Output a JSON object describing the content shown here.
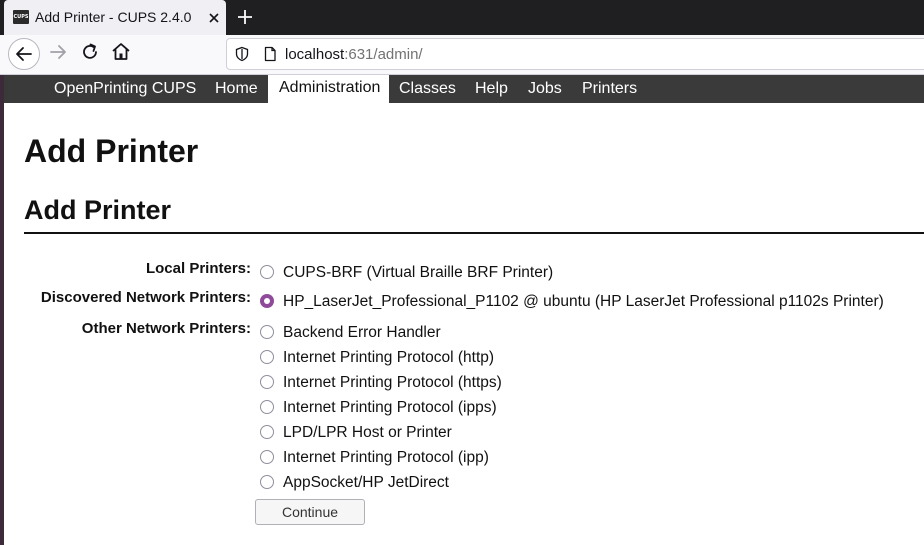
{
  "browser": {
    "tab": {
      "favicon_text": "CUPS",
      "title": "Add Printer - CUPS 2.4.0"
    },
    "url": {
      "host": "localhost",
      "rest": ":631/admin/"
    }
  },
  "cups_menu": {
    "items": [
      "OpenPrinting CUPS",
      "Home",
      "Administration",
      "Classes",
      "Help",
      "Jobs",
      "Printers"
    ],
    "active": "Administration"
  },
  "page": {
    "title": "Add Printer",
    "section_title": "Add Printer",
    "groups": [
      {
        "label": "Local Printers:",
        "options": [
          {
            "label": "CUPS-BRF (Virtual Braille BRF Printer)",
            "checked": false
          }
        ]
      },
      {
        "label": "Discovered Network Printers:",
        "options": [
          {
            "label": "HP_LaserJet_Professional_P1102 @ ubuntu (HP LaserJet Professional p1102s Printer)",
            "checked": true
          }
        ]
      },
      {
        "label": "Other Network Printers:",
        "options": [
          {
            "label": "Backend Error Handler",
            "checked": false
          },
          {
            "label": "Internet Printing Protocol (http)",
            "checked": false
          },
          {
            "label": "Internet Printing Protocol (https)",
            "checked": false
          },
          {
            "label": "Internet Printing Protocol (ipps)",
            "checked": false
          },
          {
            "label": "LPD/LPR Host or Printer",
            "checked": false
          },
          {
            "label": "Internet Printing Protocol (ipp)",
            "checked": false
          },
          {
            "label": "AppSocket/HP JetDirect",
            "checked": false
          }
        ]
      }
    ],
    "continue_label": "Continue"
  },
  "colors": {
    "radio_accent": "#8f4a9a",
    "menu_bg": "#3a3a3a",
    "tabstrip_bg": "#1f1f22"
  }
}
